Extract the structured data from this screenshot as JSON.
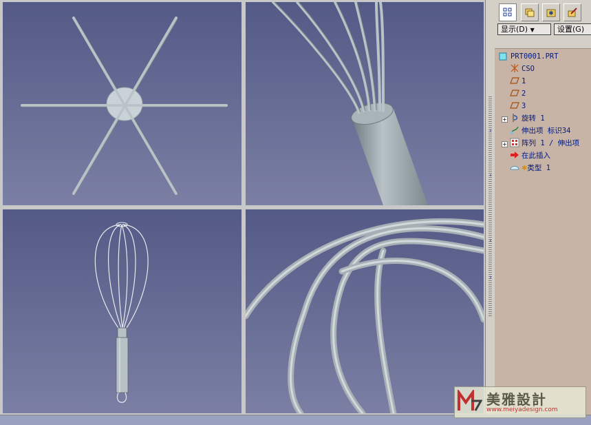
{
  "toolbar": {
    "buttons": [
      {
        "name": "model-tree-tab",
        "icon": "model-tree-icon"
      },
      {
        "name": "folder-browser-tab",
        "icon": "folders-icon"
      },
      {
        "name": "favorites-tab",
        "icon": "favorites-icon"
      },
      {
        "name": "connections-tab",
        "icon": "tools-icon"
      }
    ]
  },
  "menus": {
    "show_label": "显示(D)",
    "settings_label": "设置(G)"
  },
  "tree": {
    "root": "PRT0001.PRT",
    "items": [
      {
        "label": "CSO",
        "icon": "csys-icon"
      },
      {
        "label": "1",
        "icon": "datum-plane-icon"
      },
      {
        "label": "2",
        "icon": "datum-plane-icon"
      },
      {
        "label": "3",
        "icon": "datum-plane-icon"
      },
      {
        "label": "旋转 1",
        "icon": "revolve-icon"
      },
      {
        "label": "伸出项 标识34",
        "icon": "protrusion-icon"
      },
      {
        "label": "阵列 1 / 伸出项",
        "icon": "pattern-icon"
      },
      {
        "label": "在此插入",
        "icon": "insert-here-arrow-icon"
      },
      {
        "label": "类型 1",
        "icon": "feature-type-icon"
      }
    ]
  },
  "watermark": {
    "text": "美雅設計",
    "url": "www.meiyadesign.com"
  },
  "colors": {
    "viewport_top": "#545a86",
    "viewport_bottom": "#7b7fa4",
    "panel_bg": "#c8b3a7",
    "tree_text": "#001a80"
  }
}
